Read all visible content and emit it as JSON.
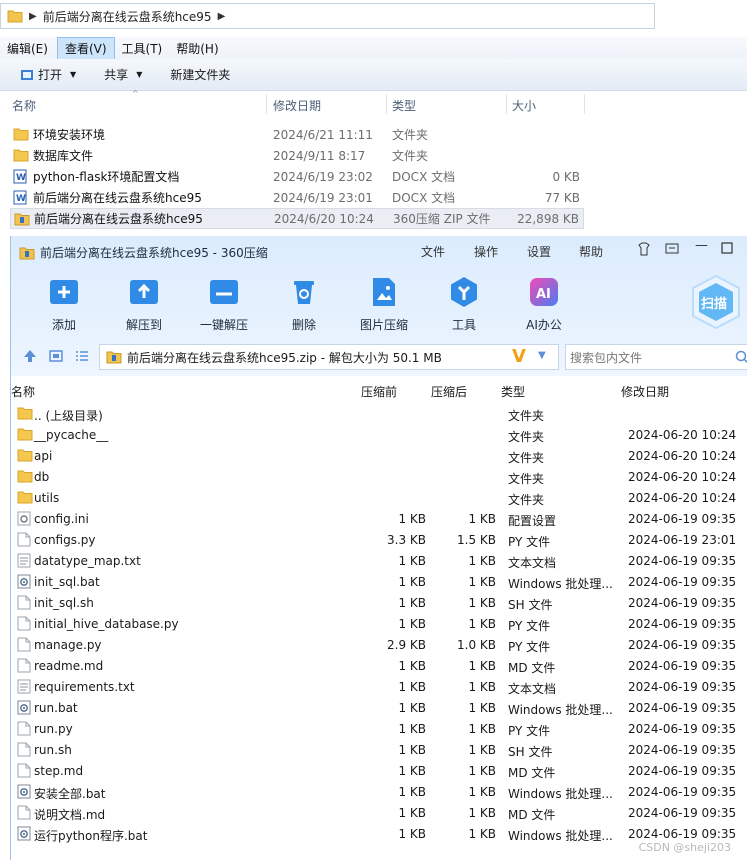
{
  "explorer": {
    "path": "前后端分离在线云盘系统hce95",
    "menu": [
      {
        "label": "编辑(E)",
        "active": false
      },
      {
        "label": "查看(V)",
        "active": true
      },
      {
        "label": "工具(T)",
        "active": false
      },
      {
        "label": "帮助(H)",
        "active": false
      }
    ],
    "toolbar": {
      "open": "打开",
      "share": "共享",
      "new_folder": "新建文件夹"
    },
    "columns": {
      "name": "名称",
      "date": "修改日期",
      "type": "类型",
      "size": "大小"
    },
    "files": [
      {
        "name": "环境安装环境",
        "date": "2024/6/21 11:11",
        "type": "文件夹",
        "size": "",
        "icon": "folder-icon",
        "selected": false
      },
      {
        "name": "数据库文件",
        "date": "2024/9/11 8:17",
        "type": "文件夹",
        "size": "",
        "icon": "folder-icon",
        "selected": false
      },
      {
        "name": "python-flask环境配置文档",
        "date": "2024/6/19 23:02",
        "type": "DOCX 文档",
        "size": "0 KB",
        "icon": "word-doc-icon",
        "selected": false
      },
      {
        "name": "前后端分离在线云盘系统hce95",
        "date": "2024/6/19 23:01",
        "type": "DOCX 文档",
        "size": "77 KB",
        "icon": "word-doc-icon",
        "selected": false
      },
      {
        "name": "前后端分离在线云盘系统hce95",
        "date": "2024/6/20 10:24",
        "type": "360压缩 ZIP 文件",
        "size": "22,898 KB",
        "icon": "zip-archive-icon",
        "selected": true
      }
    ]
  },
  "zip": {
    "title": "前后端分离在线云盘系统hce95 - 360压缩",
    "menu": [
      "文件",
      "操作",
      "设置",
      "帮助"
    ],
    "tools": [
      {
        "label": "添加",
        "icon": "add-icon",
        "color": "#2f8be6"
      },
      {
        "label": "解压到",
        "icon": "extract-to-icon",
        "color": "#2f8be6"
      },
      {
        "label": "一键解压",
        "icon": "one-click-extract-icon",
        "color": "#2f8be6"
      },
      {
        "label": "删除",
        "icon": "delete-icon",
        "color": "#2f8be6"
      },
      {
        "label": "图片压缩",
        "icon": "image-compress-icon",
        "color": "#2f8be6"
      },
      {
        "label": "工具",
        "icon": "tools-icon",
        "color": "#2f8be6"
      },
      {
        "label": "AI办公",
        "icon": "ai-office-icon",
        "color": "#7b5cf0"
      }
    ],
    "scan_label": "扫描",
    "archive_info": "前后端分离在线云盘系统hce95.zip - 解包大小为 50.1 MB",
    "search_placeholder": "搜索包内文件",
    "columns": {
      "name": "名称",
      "size": "压缩前",
      "compressed": "压缩后",
      "type": "类型",
      "date": "修改日期"
    },
    "entries": [
      {
        "name": ".. (上级目录)",
        "size": "",
        "compressed": "",
        "type": "文件夹",
        "date": "",
        "icon": "folder-icon"
      },
      {
        "name": "__pycache__",
        "size": "",
        "compressed": "",
        "type": "文件夹",
        "date": "2024-06-20 10:24",
        "icon": "folder-icon"
      },
      {
        "name": "api",
        "size": "",
        "compressed": "",
        "type": "文件夹",
        "date": "2024-06-20 10:24",
        "icon": "folder-icon"
      },
      {
        "name": "db",
        "size": "",
        "compressed": "",
        "type": "文件夹",
        "date": "2024-06-20 10:24",
        "icon": "folder-icon"
      },
      {
        "name": "utils",
        "size": "",
        "compressed": "",
        "type": "文件夹",
        "date": "2024-06-20 10:24",
        "icon": "folder-icon"
      },
      {
        "name": "config.ini",
        "size": "1 KB",
        "compressed": "1 KB",
        "type": "配置设置",
        "date": "2024-06-19 09:35",
        "icon": "settings-file-icon"
      },
      {
        "name": "configs.py",
        "size": "3.3 KB",
        "compressed": "1.5 KB",
        "type": "PY 文件",
        "date": "2024-06-19 23:01",
        "icon": "file-icon"
      },
      {
        "name": "datatype_map.txt",
        "size": "1 KB",
        "compressed": "1 KB",
        "type": "文本文档",
        "date": "2024-06-19 09:35",
        "icon": "text-file-icon"
      },
      {
        "name": "init_sql.bat",
        "size": "1 KB",
        "compressed": "1 KB",
        "type": "Windows 批处理...",
        "date": "2024-06-19 09:35",
        "icon": "batch-file-icon"
      },
      {
        "name": "init_sql.sh",
        "size": "1 KB",
        "compressed": "1 KB",
        "type": "SH 文件",
        "date": "2024-06-19 09:35",
        "icon": "file-icon"
      },
      {
        "name": "initial_hive_database.py",
        "size": "1 KB",
        "compressed": "1 KB",
        "type": "PY 文件",
        "date": "2024-06-19 09:35",
        "icon": "file-icon"
      },
      {
        "name": "manage.py",
        "size": "2.9 KB",
        "compressed": "1.0 KB",
        "type": "PY 文件",
        "date": "2024-06-19 09:35",
        "icon": "file-icon"
      },
      {
        "name": "readme.md",
        "size": "1 KB",
        "compressed": "1 KB",
        "type": "MD 文件",
        "date": "2024-06-19 09:35",
        "icon": "file-icon"
      },
      {
        "name": "requirements.txt",
        "size": "1 KB",
        "compressed": "1 KB",
        "type": "文本文档",
        "date": "2024-06-19 09:35",
        "icon": "text-file-icon"
      },
      {
        "name": "run.bat",
        "size": "1 KB",
        "compressed": "1 KB",
        "type": "Windows 批处理...",
        "date": "2024-06-19 09:35",
        "icon": "batch-file-icon"
      },
      {
        "name": "run.py",
        "size": "1 KB",
        "compressed": "1 KB",
        "type": "PY 文件",
        "date": "2024-06-19 09:35",
        "icon": "file-icon"
      },
      {
        "name": "run.sh",
        "size": "1 KB",
        "compressed": "1 KB",
        "type": "SH 文件",
        "date": "2024-06-19 09:35",
        "icon": "file-icon"
      },
      {
        "name": "step.md",
        "size": "1 KB",
        "compressed": "1 KB",
        "type": "MD 文件",
        "date": "2024-06-19 09:35",
        "icon": "file-icon"
      },
      {
        "name": "安装全部.bat",
        "size": "1 KB",
        "compressed": "1 KB",
        "type": "Windows 批处理...",
        "date": "2024-06-19 09:35",
        "icon": "batch-file-icon"
      },
      {
        "name": "说明文档.md",
        "size": "1 KB",
        "compressed": "1 KB",
        "type": "MD 文件",
        "date": "2024-06-19 09:35",
        "icon": "file-icon"
      },
      {
        "name": "运行python程序.bat",
        "size": "1 KB",
        "compressed": "1 KB",
        "type": "Windows 批处理...",
        "date": "2024-06-19 09:35",
        "icon": "batch-file-icon"
      }
    ]
  },
  "watermark": "CSDN @sheji203"
}
